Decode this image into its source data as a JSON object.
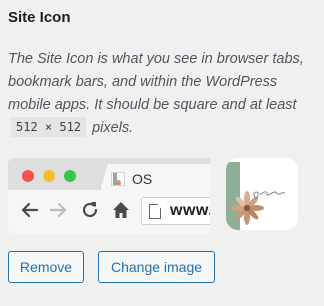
{
  "section": {
    "title": "Site Icon",
    "description_before": "The Site Icon is what you see in browser tabs, bookmark bars, and within the WordPress mobile apps. It should be square and at least",
    "size_code": "512 × 512",
    "description_after": "pixels."
  },
  "browser_preview": {
    "tab_title": "OS",
    "address_text": "www.",
    "icons": [
      "back-arrow-icon",
      "forward-arrow-icon",
      "reload-icon",
      "home-icon",
      "page-icon"
    ]
  },
  "site_icon_preview": {
    "signature_text": "Cabinet"
  },
  "actions": {
    "remove_label": "Remove",
    "change_label": "Change image"
  },
  "colors": {
    "accent": "#2271b1",
    "background": "#f0f0f1",
    "dot_red": "#f5524f",
    "dot_yellow": "#f6bd2f",
    "dot_green": "#34c749",
    "icon_green": "#8fae98"
  }
}
